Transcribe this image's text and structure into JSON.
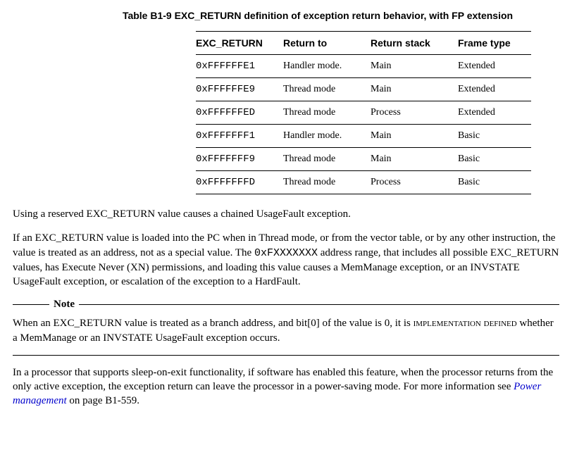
{
  "table": {
    "title": "Table B1-9 EXC_RETURN definition of exception return behavior, with FP extension",
    "headers": [
      "EXC_RETURN",
      "Return to",
      "Return stack",
      "Frame type"
    ],
    "rows": [
      {
        "c0": "0xFFFFFFE1",
        "c1": "Handler mode.",
        "c2": "Main",
        "c3": "Extended"
      },
      {
        "c0": "0xFFFFFFE9",
        "c1": "Thread mode",
        "c2": "Main",
        "c3": "Extended"
      },
      {
        "c0": "0xFFFFFFED",
        "c1": "Thread mode",
        "c2": "Process",
        "c3": "Extended"
      },
      {
        "c0": "0xFFFFFFF1",
        "c1": "Handler mode.",
        "c2": "Main",
        "c3": "Basic"
      },
      {
        "c0": "0xFFFFFFF9",
        "c1": "Thread mode",
        "c2": "Main",
        "c3": "Basic"
      },
      {
        "c0": "0xFFFFFFFD",
        "c1": "Thread mode",
        "c2": "Process",
        "c3": "Basic"
      }
    ]
  },
  "para1": "Using a reserved EXC_RETURN value causes a chained UsageFault exception.",
  "para2_a": "If an EXC_RETURN value is loaded into the PC when in Thread mode, or from the vector table, or by any other instruction, the value is treated as an address, not as a special value. The ",
  "para2_code": "0xFXXXXXXX",
  "para2_b": " address range, that includes all possible EXC_RETURN values, has Execute Never (XN) permissions, and loading this value causes a MemManage exception, or an INVSTATE UsageFault exception, or escalation of the exception to a HardFault.",
  "note_label": "Note",
  "note_a": "When an EXC_RETURN value is treated as a branch address, and bit[0] of the value is 0, it is ",
  "note_sc": "implementation defined",
  "note_b": " whether a MemManage or an INVSTATE UsageFault exception occurs.",
  "para3_a": "In a processor that supports sleep-on-exit functionality, if software has enabled this feature, when the processor returns from the only active exception, the exception return can leave the processor in a power-saving mode. For more information see ",
  "para3_link": "Power management",
  "para3_b": " on page B1-559."
}
